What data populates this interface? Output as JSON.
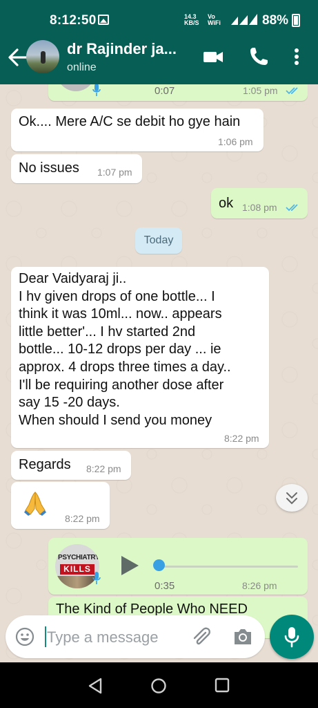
{
  "status_bar": {
    "time": "8:12:50",
    "net_speed": "14.3\nKB/S",
    "volte": "Vo\nWiFi",
    "battery": "88%"
  },
  "header": {
    "contact_name": "dr Rajinder ja...",
    "status": "online"
  },
  "messages": {
    "voice_top": {
      "duration": "0:07",
      "time": "1:05 pm"
    },
    "m1": {
      "text": "Ok.... Mere A/C se debit ho gye hain",
      "time": "1:06 pm"
    },
    "m2": {
      "text": "No issues",
      "time": "1:07 pm"
    },
    "m3": {
      "text": "ok",
      "time": "1:08 pm"
    },
    "day_divider": "Today",
    "m4": {
      "text": "Dear Vaidyaraj ji..\nI hv given drops of one bottle... I\nthink it was 10ml... now.. appears\nlittle better'... I hv started 2nd\nbottle... 10-12 drops per day ... ie\napprox. 4 drops three times a day..\nI'll be requiring another dose after\nsay 15 -20 days.\nWhen should I send you money",
      "time": "8:22 pm"
    },
    "m5": {
      "text": "Regards",
      "time": "8:22 pm"
    },
    "m6": {
      "emoji": "folded-hands",
      "time": "8:22 pm"
    },
    "voice_bottom": {
      "thumb_line1": "PSYCHIATRY",
      "thumb_line2": "KILLS",
      "duration": "0:35",
      "time": "8:26 pm",
      "progress": 0
    },
    "partial_text": "The Kind of People Who NEED"
  },
  "composer": {
    "placeholder": "Type a message"
  },
  "colors": {
    "header": "#075e54",
    "outgoing": "#dcf8c6",
    "incoming": "#ffffff",
    "read_ticks": "#4fb6ec",
    "fab": "#00897b"
  }
}
